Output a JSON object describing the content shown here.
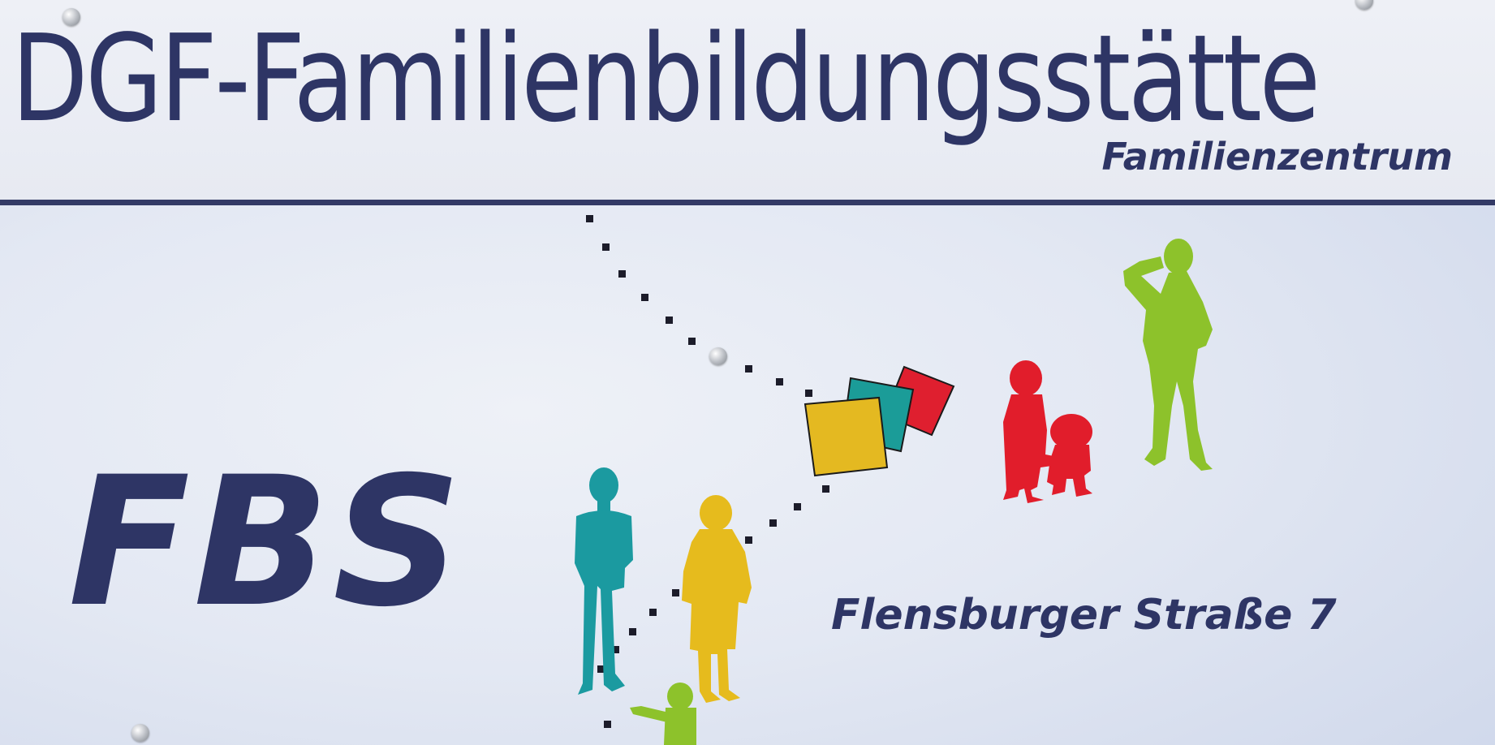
{
  "sign": {
    "title": "DGF-Familienbildungsstätte",
    "subtitle": "Familienzentrum",
    "logo_text": "FBS",
    "address": "Flensburger Straße 7"
  },
  "colors": {
    "text_navy": "#2e3565",
    "figure_teal": "#1b9aa0",
    "figure_yellow": "#e6bb1d",
    "figure_red": "#e11d2b",
    "figure_green": "#8dc22b",
    "square_yellow": "#e4b921",
    "square_teal": "#1b9c98",
    "square_red": "#df1f2f"
  },
  "icons": [
    "screw-icon",
    "kite-squares-icon",
    "person-silhouette-icon"
  ]
}
